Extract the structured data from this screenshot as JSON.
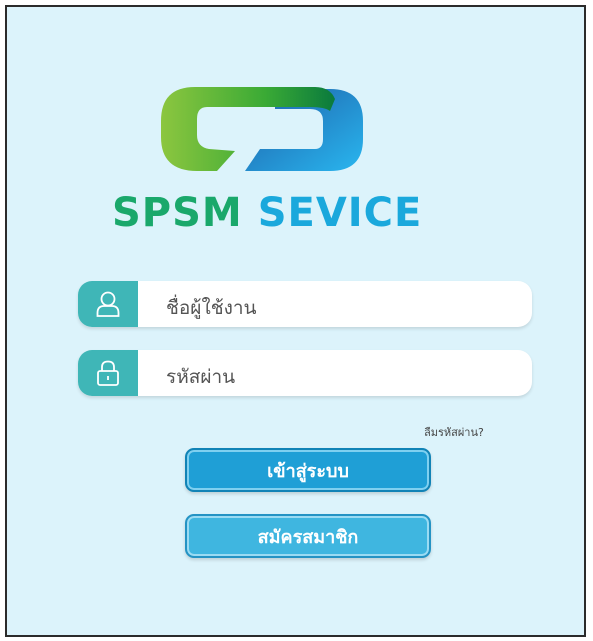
{
  "brand": {
    "name_part1": "SPSM",
    "name_part2": "SEVICE",
    "logo_icon": "speech-bubble-logo",
    "color_green": "#1aa86b",
    "color_blue": "#1aa8dc"
  },
  "form": {
    "username": {
      "placeholder": "ชื่อผู้ใช้งาน",
      "icon": "user-icon"
    },
    "password": {
      "placeholder": "รหัสผ่าน",
      "icon": "lock-icon"
    },
    "forgot_password": "ลืมรหัสผ่าน?"
  },
  "buttons": {
    "login": "เข้าสู่ระบบ",
    "register": "สมัครสมาชิก"
  },
  "colors": {
    "background": "#dcf3fb",
    "field_cap": "#3fb6b7",
    "login_button": "#1f9fd6",
    "register_button": "#3fb6e0"
  }
}
